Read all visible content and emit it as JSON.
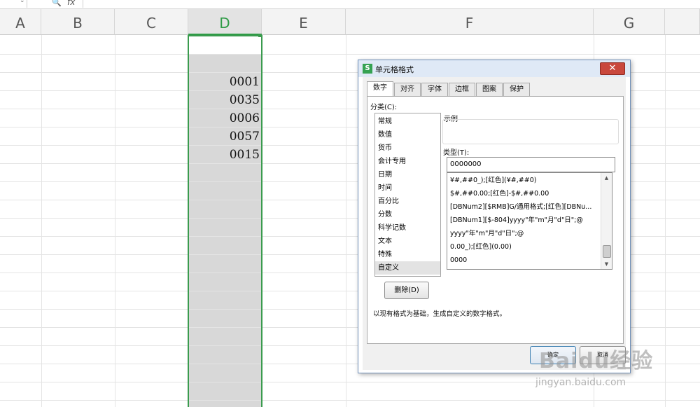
{
  "toolbar": {
    "zoom_icon": "zoom-icon",
    "fx_label": "fx"
  },
  "columns": [
    "A",
    "B",
    "C",
    "D",
    "E",
    "F",
    "G"
  ],
  "cells": [
    "0001",
    "0035",
    "0006",
    "0057",
    "0015"
  ],
  "dialog": {
    "title": "单元格格式",
    "close_label": "✕",
    "tabs": [
      "数字",
      "对齐",
      "字体",
      "边框",
      "图案",
      "保护"
    ],
    "category_label": "分类(C):",
    "categories": [
      "常规",
      "数值",
      "货币",
      "会计专用",
      "日期",
      "时间",
      "百分比",
      "分数",
      "科学记数",
      "文本",
      "特殊",
      "自定义"
    ],
    "selected_category": "自定义",
    "sample_label": "示例",
    "type_label": "类型(T):",
    "type_value": "0000000",
    "formats": [
      "¥#,##0_);[红色](¥#,##0)",
      "$#,##0.00;[红色]-$#,##0.00",
      "[DBNum2][$RMB]G/通用格式;[红色][DBNu...",
      "[DBNum1][$-804]yyyy\"年\"m\"月\"d\"日\";@",
      "yyyy\"年\"m\"月\"d\"日\";@",
      "0.00_);[红色](0.00)",
      "0000"
    ],
    "delete_label": "删除(D)",
    "description": "以现有格式为基础，生成自定义的数字格式。",
    "ok_label": "确定",
    "cancel_label": "取消"
  },
  "watermark": {
    "text": "Baidu经验",
    "sub": "jingyan.baidu.com"
  }
}
